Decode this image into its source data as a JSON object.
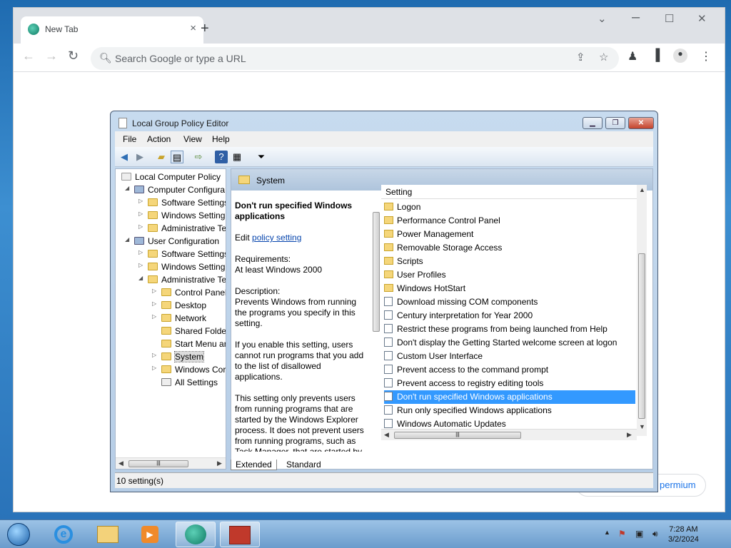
{
  "browser": {
    "tab_title": "New Tab",
    "tab_close": "×",
    "new_tab": "+",
    "omnibox_placeholder": "Search Google or type a URL",
    "premium_label": "permium"
  },
  "gpedit": {
    "title": "Local Group Policy Editor",
    "menu": [
      "File",
      "Action",
      "View",
      "Help"
    ],
    "tree": [
      {
        "label": "Local Computer Policy",
        "level": 0
      },
      {
        "label": "Computer Configura",
        "level": 1
      },
      {
        "label": "Software Settings",
        "level": 2
      },
      {
        "label": "Windows Setting",
        "level": 2
      },
      {
        "label": "Administrative Te",
        "level": 2
      },
      {
        "label": "User Configuration",
        "level": 1
      },
      {
        "label": "Software Settings",
        "level": 2
      },
      {
        "label": "Windows Setting",
        "level": 2
      },
      {
        "label": "Administrative Te",
        "level": 2
      },
      {
        "label": "Control Panel",
        "level": 3
      },
      {
        "label": "Desktop",
        "level": 3
      },
      {
        "label": "Network",
        "level": 3
      },
      {
        "label": "Shared Folder",
        "level": 3
      },
      {
        "label": "Start Menu ar",
        "level": 3
      },
      {
        "label": "System",
        "level": 3
      },
      {
        "label": "Windows Cor",
        "level": 3
      },
      {
        "label": "All Settings",
        "level": 3
      }
    ],
    "header_title": "System",
    "desc": {
      "heading": "Don't run specified Windows applications",
      "edit_prefix": "Edit",
      "edit_link": "policy setting",
      "req_label": "Requirements:",
      "req_value": "At least Windows 2000",
      "desc_label": "Description:",
      "p1": "Prevents Windows from running the programs you specify in this setting.",
      "p2": "If you enable this setting, users cannot run programs that you add to the list of disallowed applications.",
      "p3": "This setting only prevents users from running programs that are started by the Windows Explorer process. It does not prevent users from running programs, such as Task Manager, that are started by"
    },
    "list_header": "Setting",
    "list": [
      {
        "label": "Logon",
        "type": "folder"
      },
      {
        "label": "Performance Control Panel",
        "type": "folder"
      },
      {
        "label": "Power Management",
        "type": "folder"
      },
      {
        "label": "Removable Storage Access",
        "type": "folder"
      },
      {
        "label": "Scripts",
        "type": "folder"
      },
      {
        "label": "User Profiles",
        "type": "folder"
      },
      {
        "label": "Windows HotStart",
        "type": "folder"
      },
      {
        "label": "Download missing COM components",
        "type": "policy"
      },
      {
        "label": "Century interpretation for Year 2000",
        "type": "policy"
      },
      {
        "label": "Restrict these programs from being launched from Help",
        "type": "policy"
      },
      {
        "label": "Don't display the Getting Started welcome screen at logon",
        "type": "policy"
      },
      {
        "label": "Custom User Interface",
        "type": "policy"
      },
      {
        "label": "Prevent access to the command prompt",
        "type": "policy"
      },
      {
        "label": "Prevent access to registry editing tools",
        "type": "policy"
      },
      {
        "label": "Don't run specified Windows applications",
        "type": "policy"
      },
      {
        "label": "Run only specified Windows applications",
        "type": "policy"
      },
      {
        "label": "Windows Automatic Updates",
        "type": "policy"
      }
    ],
    "tabs": [
      "Extended",
      "Standard"
    ],
    "status": "10 setting(s)"
  },
  "taskbar": {
    "time": "7:28 AM",
    "date": "3/2/2024"
  }
}
